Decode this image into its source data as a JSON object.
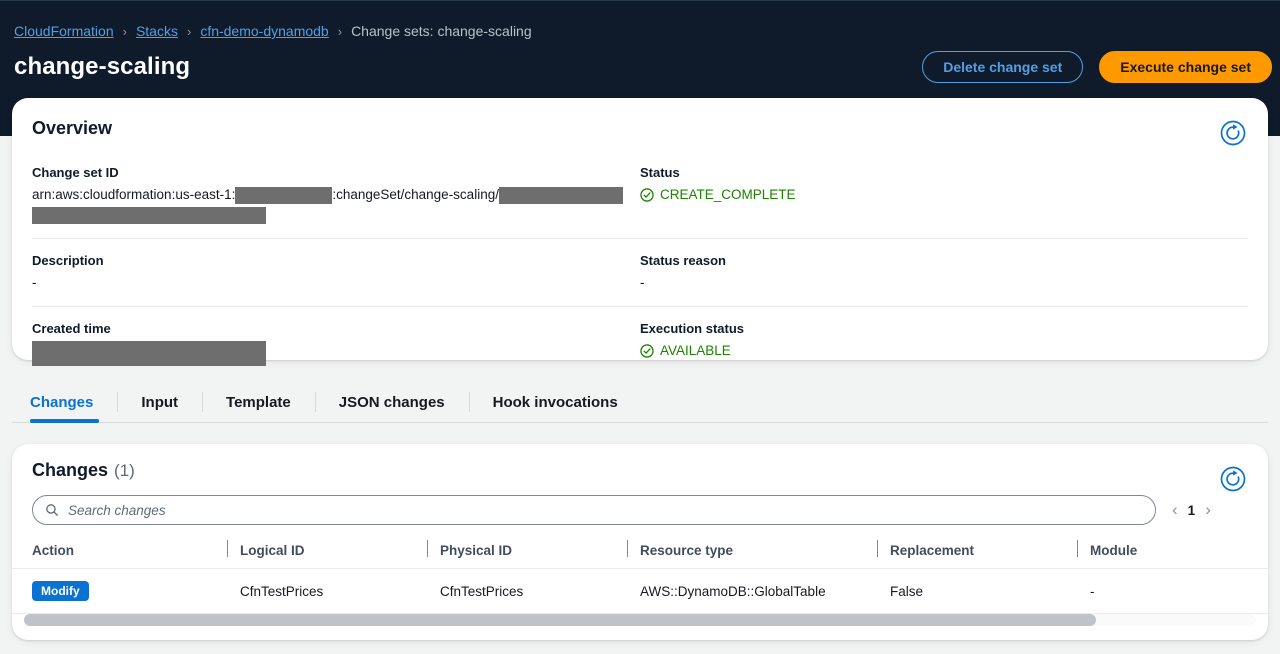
{
  "breadcrumb": {
    "items": [
      {
        "label": "CloudFormation",
        "type": "link"
      },
      {
        "label": "Stacks",
        "type": "link"
      },
      {
        "label": "cfn-demo-dynamodb",
        "type": "link"
      },
      {
        "label": "Change sets: change-scaling",
        "type": "current"
      }
    ],
    "separator": "›"
  },
  "page": {
    "title": "change-scaling"
  },
  "header_actions": {
    "delete_label": "Delete change set",
    "execute_label": "Execute change set"
  },
  "overview": {
    "title": "Overview",
    "refresh_icon": "refresh-icon",
    "fields": {
      "change_set_id_label": "Change set ID",
      "change_set_id_prefix": "arn:aws:cloudformation:us-east-1:",
      "change_set_id_middle": ":changeSet/change-scaling/",
      "status_label": "Status",
      "status_value": "CREATE_COMPLETE",
      "description_label": "Description",
      "description_value": "-",
      "status_reason_label": "Status reason",
      "status_reason_value": "-",
      "created_time_label": "Created time",
      "execution_status_label": "Execution status",
      "execution_status_value": "AVAILABLE"
    }
  },
  "tabs": [
    {
      "label": "Changes",
      "active": true
    },
    {
      "label": "Input",
      "active": false
    },
    {
      "label": "Template",
      "active": false
    },
    {
      "label": "JSON changes",
      "active": false
    },
    {
      "label": "Hook invocations",
      "active": false
    }
  ],
  "changes": {
    "title": "Changes",
    "count": "(1)",
    "refresh_icon": "refresh-icon",
    "search": {
      "icon": "search-icon",
      "placeholder": "Search changes",
      "value": ""
    },
    "pagination": {
      "prev": "‹",
      "page": "1",
      "next": "›"
    },
    "columns": [
      "Action",
      "Logical ID",
      "Physical ID",
      "Resource type",
      "Replacement",
      "Module"
    ],
    "rows": [
      {
        "action": "Modify",
        "logical_id": "CfnTestPrices",
        "physical_id": "CfnTestPrices",
        "resource_type": "AWS::DynamoDB::GlobalTable",
        "replacement": "False",
        "module": "-"
      }
    ]
  },
  "colors": {
    "header_bg": "#0f1b2a",
    "link": "#539fe5",
    "accent_orange": "#ff9900",
    "accent_blue": "#0972d3",
    "status_green": "#1d8102",
    "redaction": "#6e6e6e"
  }
}
